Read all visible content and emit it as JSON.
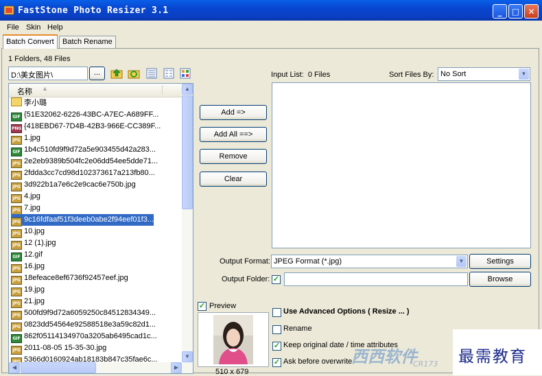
{
  "window": {
    "title": "FastStone Photo Resizer 3.1",
    "minimize": "_",
    "maximize": "□",
    "close": "✕"
  },
  "menu": [
    "File",
    "Skin",
    "Help"
  ],
  "tabs": [
    "Batch Convert",
    "Batch Rename"
  ],
  "folder_summary": "1 Folders, 48 Files",
  "path": {
    "value": "D:\\美女图片\\",
    "browse_label": "..."
  },
  "file_list": {
    "header": "名称",
    "items": [
      {
        "name": "李小璐",
        "type": "folder"
      },
      {
        "name": "{51E32062-6226-43BC-A7EC-A689FF...",
        "type": "gif"
      },
      {
        "name": "{418EBD67-7D4B-42B3-966E-CC389F...",
        "type": "png"
      },
      {
        "name": "1.jpg",
        "type": "jpg"
      },
      {
        "name": "1b4c510fd9f9d72a5e903455d42a283...",
        "type": "gif"
      },
      {
        "name": "2e2eb9389b504fc2e06dd54ee5dde71...",
        "type": "jpg"
      },
      {
        "name": "2fdda3cc7cd98d102373617a213fb80...",
        "type": "jpg"
      },
      {
        "name": "3d922b1a7e6c2e9cac6e750b.jpg",
        "type": "jpg"
      },
      {
        "name": "4.jpg",
        "type": "jpg"
      },
      {
        "name": "7.jpg",
        "type": "jpg"
      },
      {
        "name": "9c16fdfaaf51f3deeb0abe2f94eef01f3...",
        "type": "jpg",
        "selected": true
      },
      {
        "name": "10.jpg",
        "type": "jpg"
      },
      {
        "name": "12 (1).jpg",
        "type": "jpg"
      },
      {
        "name": "12.gif",
        "type": "gif"
      },
      {
        "name": "16.jpg",
        "type": "jpg"
      },
      {
        "name": "18efeace8ef6736f92457eef.jpg",
        "type": "jpg"
      },
      {
        "name": "19.jpg",
        "type": "jpg"
      },
      {
        "name": "21.jpg",
        "type": "jpg"
      },
      {
        "name": "500fd9f9d72a6059250c84512834349...",
        "type": "jpg"
      },
      {
        "name": "0823dd54564e92588518e3a59c82d1...",
        "type": "jpg"
      },
      {
        "name": "862f05114134970a3205ab6495cad1c...",
        "type": "gif"
      },
      {
        "name": "2011-08-05 15-35-30.jpg",
        "type": "jpg"
      },
      {
        "name": "5366d0160924ab18183b847c35fae6c...",
        "type": "jpg"
      }
    ]
  },
  "buttons": {
    "add": "Add =>",
    "add_all": "Add All ==>",
    "remove": "Remove",
    "clear": "Clear",
    "settings": "Settings",
    "browse": "Browse"
  },
  "input_list": {
    "label": "Input List:",
    "count": "0 Files"
  },
  "sort": {
    "label": "Sort Files By:",
    "value": "No Sort"
  },
  "output_format": {
    "label": "Output Format:",
    "value": "JPEG Format (*.jpg)"
  },
  "output_folder": {
    "label": "Output Folder:",
    "value": ""
  },
  "preview": {
    "label": "Preview",
    "checked": true,
    "dimensions": "510 x 679"
  },
  "options": [
    {
      "label": "Use Advanced Options ( Resize ... )",
      "checked": false,
      "bold": true
    },
    {
      "label": "Rename",
      "checked": false
    },
    {
      "label": "Keep original date / time attributes",
      "checked": true
    },
    {
      "label": "Ask before overwrite",
      "checked": true
    }
  ],
  "watermark": {
    "site_text": "西西软件",
    "brand_text": "最需教育",
    "sub_text": "CR173"
  },
  "icons": [
    "app-icon",
    "folder-up-icon",
    "refresh-icon",
    "view-thumbnails-icon",
    "view-list-icon",
    "view-details-icon",
    "sort-asc-icon"
  ]
}
